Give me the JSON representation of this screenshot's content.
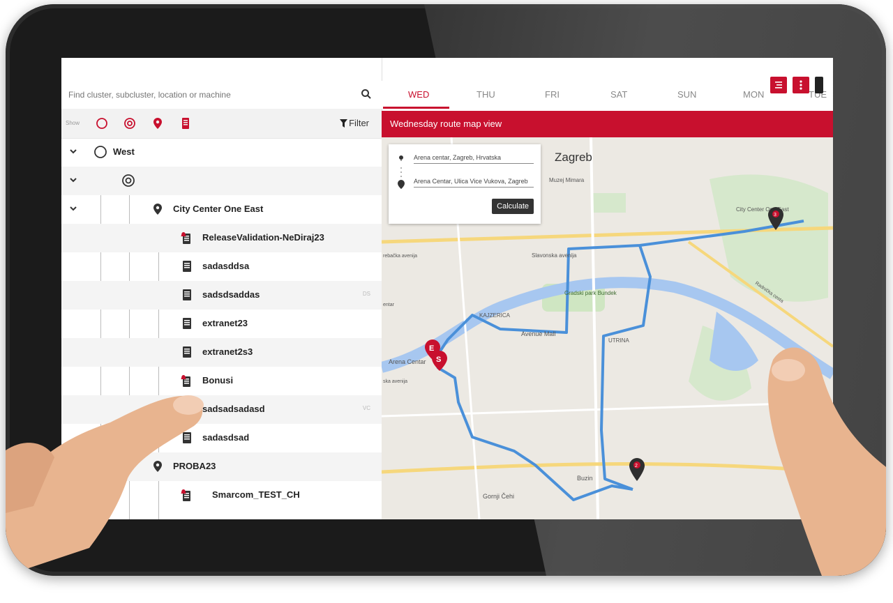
{
  "search": {
    "placeholder": "Find cluster, subcluster, location or machine"
  },
  "showbar": {
    "label": "Show",
    "filter_label": "Filter"
  },
  "tree": [
    {
      "label": "West",
      "icon": "cluster-circle-icon",
      "level": 0,
      "expanded": true
    },
    {
      "label": "",
      "icon": "subcluster-target-icon",
      "level": 1,
      "expanded": true
    },
    {
      "label": "City Center One East",
      "icon": "location-pin-icon",
      "level": 2,
      "expanded": true
    },
    {
      "label": "ReleaseValidation-NeDiraj23",
      "icon": "machine-alert-icon",
      "level": 3
    },
    {
      "label": "sadasddsa",
      "icon": "machine-icon",
      "level": 3
    },
    {
      "label": "sadsdsaddas",
      "icon": "machine-icon",
      "level": 3,
      "tag": "DS"
    },
    {
      "label": "extranet23",
      "icon": "machine-icon",
      "level": 3
    },
    {
      "label": "extranet2s3",
      "icon": "machine-icon",
      "level": 3
    },
    {
      "label": "Bonusi",
      "icon": "machine-alert-icon",
      "level": 3
    },
    {
      "label": "sadsadsadasd",
      "icon": "machine-icon",
      "level": 3,
      "tag": "VC"
    },
    {
      "label": "sadasdsad",
      "icon": "machine-icon",
      "level": 3
    },
    {
      "label": "PROBA23",
      "icon": "location-pin-icon",
      "level": 2
    },
    {
      "label": "Smarcom_TEST_CH",
      "icon": "machine-alert-icon",
      "level": 3
    }
  ],
  "days": {
    "active": "WED",
    "items": [
      "WED",
      "THU",
      "FRI",
      "SAT",
      "SUN",
      "MON",
      "TUE"
    ]
  },
  "map_header": {
    "title": "Wednesday route map view"
  },
  "route_card": {
    "from": "Arena centar, Zagreb, Hrvatska",
    "to": "Arena Centar, Ulica Vice Vukova, Zagreb",
    "button": "Calculate"
  },
  "map_labels": {
    "city": "Zagreb",
    "muzej": "Muzej Mimara",
    "slavonska": "Slavonska avenija",
    "park": "Gradski park Bundek",
    "kajzerica": "KAJZERICA",
    "avenue": "Avenue Mall",
    "utrina": "UTRINA",
    "arena": "Arena Centar",
    "buzin": "Buzin",
    "gornji": "Gornji Čehi",
    "citycenter": "City Center One East",
    "radnicka": "Radnička cesta",
    "grebacka": "rebačka avenija",
    "jadranska": "ska avenija",
    "centar": "entar"
  },
  "markers": {
    "end": "E",
    "start": "S",
    "stop2": "2",
    "stop3": "3"
  },
  "colors": {
    "brand_red": "#c8102e",
    "route_blue": "#4a90d9",
    "marker_dark": "#2f2f2f"
  }
}
